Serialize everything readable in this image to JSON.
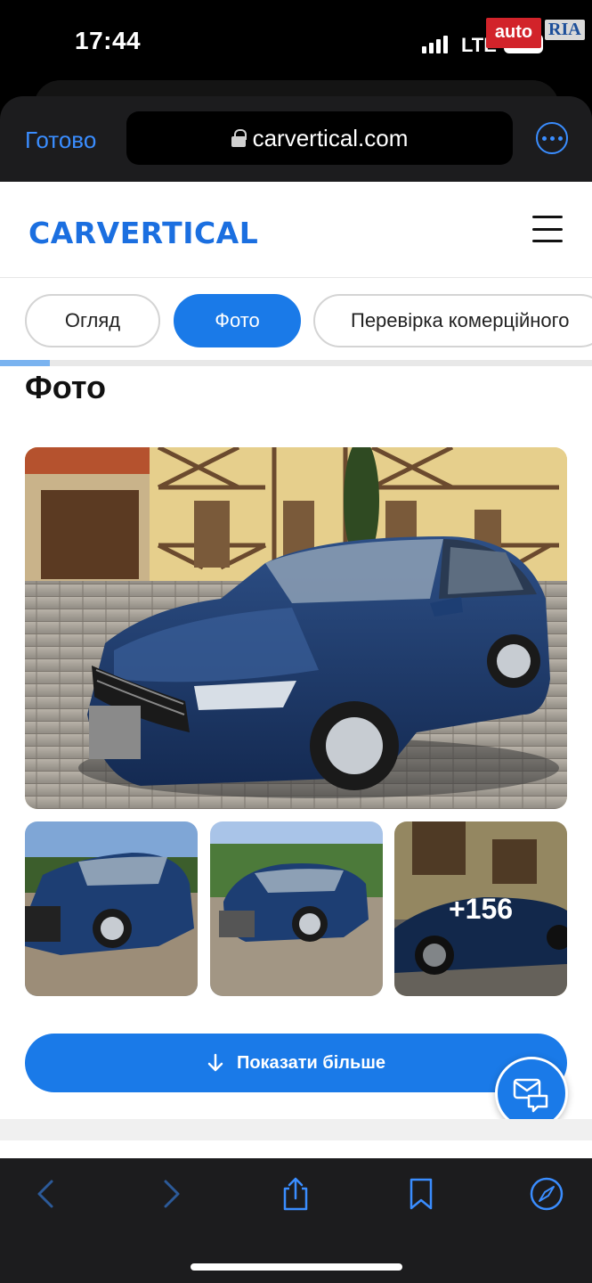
{
  "status_bar": {
    "time": "17:44",
    "network": "LTE",
    "battery": "22"
  },
  "watermark": {
    "auto": "auto",
    "ria": "RIA"
  },
  "browser": {
    "done_label": "Готово",
    "url": "carvertical.com"
  },
  "site": {
    "logo": "CARVERTICAL"
  },
  "tabs": [
    {
      "label": "Огляд",
      "active": false
    },
    {
      "label": "Фото",
      "active": true
    },
    {
      "label": "Перевірка комерційного",
      "active": false
    }
  ],
  "photos": {
    "title": "Фото",
    "more_count": "+156",
    "show_more_label": "Показати більше"
  },
  "colors": {
    "accent": "#1a7ae8",
    "safari_blue": "#3a8dff",
    "car_blue": "#1d3e73"
  },
  "toolbar": {
    "icons": [
      "back-icon",
      "forward-icon",
      "share-icon",
      "bookmarks-icon",
      "compass-icon"
    ]
  }
}
